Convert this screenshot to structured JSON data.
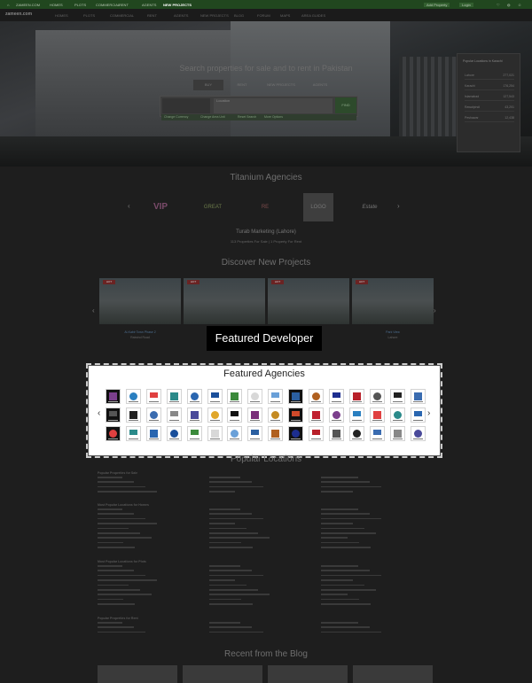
{
  "topbar": {
    "items": [
      "ZAMEEN.COM",
      "HOMES",
      "PLOTS",
      "COMMERCIAL",
      "RENT",
      "AGENTS",
      "NEW PROJECTS"
    ],
    "right_label": "Add Property",
    "login_label": "Login"
  },
  "navbar": {
    "logo": "zameen.com",
    "items": [
      "HOMES",
      "PLOTS",
      "COMMERCIAL",
      "RENT",
      "AGENTS",
      "NEW PROJECTS",
      "BLOG",
      "FORUM",
      "MAPS",
      "AREA GUIDES"
    ]
  },
  "hero": {
    "title": "Search properties for sale and to rent in Pakistan",
    "tabs": [
      "BUY",
      "RENT",
      "NEW PROJECTS",
      "AGENTS"
    ],
    "search_placeholder": "Location",
    "search_button": "FIND",
    "links": [
      "Change Currency",
      "Change Area Unit",
      "Reset Search",
      "More Options"
    ],
    "popular_card": {
      "title": "Popular Locations in Karachi",
      "rows": [
        {
          "name": "Lahore",
          "count": "277,021"
        },
        {
          "name": "Karachi",
          "count": "176,254"
        },
        {
          "name": "Islamabad",
          "count": "127,543"
        },
        {
          "name": "Rawalpindi",
          "count": "43,201"
        },
        {
          "name": "Peshawar",
          "count": "12,438"
        }
      ]
    }
  },
  "titanium": {
    "title": "Titanium Agencies",
    "logos": [
      "VIP",
      "GREAT",
      "RE",
      "LOGO",
      "Estate"
    ],
    "agency_name": "Turab Marketing (Lahore)",
    "agency_stats": "113 Properties For Sale | 1 Property For Rent"
  },
  "projects": {
    "title": "Discover New Projects",
    "badge": "HOT",
    "captions": [
      "Al-Kabir Town Phase 2",
      "",
      "",
      "Park View"
    ],
    "subcaptions": [
      "Raiwind Road",
      "",
      "",
      "Lahore"
    ]
  },
  "tooltip": {
    "text": "Featured Developer"
  },
  "featured_agencies": {
    "title": "Featured Agencies",
    "logo_count_per_row": 16,
    "rows": 3
  },
  "popular_locations": {
    "title": "Popular Locations",
    "groups": [
      "Popular Properties for Sale",
      "Most Popular Locations for Homes",
      "Most Popular Locations for Plots",
      "Popular Properties for Rent"
    ],
    "cities": [
      "Lahore",
      "Karachi",
      "Islamabad Rawalpindi"
    ]
  },
  "blog": {
    "title": "Recent from the Blog"
  },
  "colors": {
    "topbar": "#21471f",
    "overlay": "#1e1e1e",
    "tooltip_bg": "#000000"
  }
}
